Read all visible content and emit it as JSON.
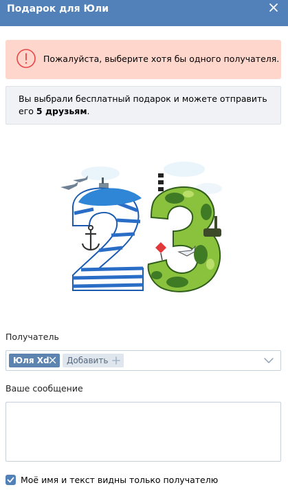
{
  "window": {
    "title": "Подарок для Юли"
  },
  "error": {
    "text": "Пожалуйста, выберите хотя бы одного получателя."
  },
  "info": {
    "text_before": "Вы выбрали бесплатный подарок и можете отправить его ",
    "text_bold": "5 друзьям",
    "text_after": "."
  },
  "gift": {
    "icon": "number-23-gift-image"
  },
  "recipient": {
    "label": "Получатель",
    "selected": [
      "Юля Xd"
    ],
    "add_label": "Добавить"
  },
  "message": {
    "label": "Ваше сообщение",
    "value": ""
  },
  "privacy": {
    "label": "Моё имя и текст видны только получателю",
    "checked": true
  },
  "colors": {
    "header": "#5181b8",
    "error_bg": "#ffd6cc",
    "info_bg": "#f0f2f5",
    "chip": "#5d83b0",
    "error_icon": "#e64646"
  }
}
